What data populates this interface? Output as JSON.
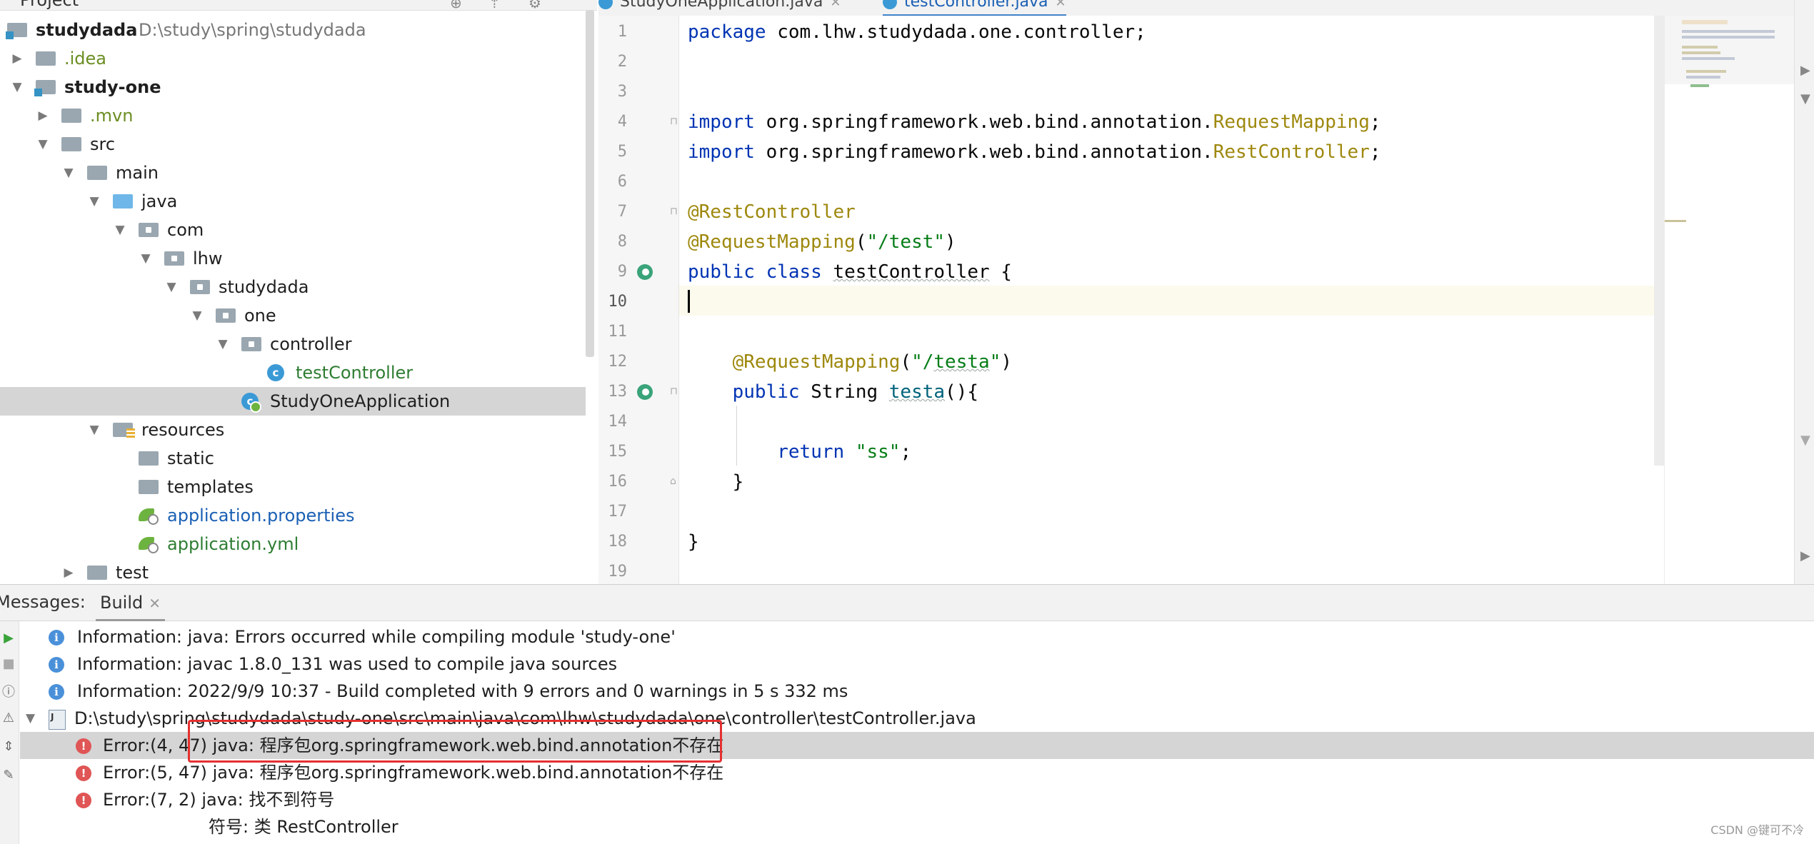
{
  "project": {
    "header": "Project",
    "tree": [
      {
        "label": "studydada",
        "path": "D:\\study\\spring\\studydada",
        "icon": "module",
        "depth": 0,
        "arrow": "none",
        "style": "bold"
      },
      {
        "label": ".idea",
        "icon": "folder",
        "depth": 0,
        "arrow": "right",
        "style": "olive"
      },
      {
        "label": "study-one",
        "icon": "module",
        "depth": 0,
        "arrow": "down",
        "style": "bold"
      },
      {
        "label": ".mvn",
        "icon": "folder",
        "depth": 1,
        "arrow": "right",
        "style": "olive"
      },
      {
        "label": "src",
        "icon": "folder",
        "depth": 1,
        "arrow": "down",
        "style": "normal"
      },
      {
        "label": "main",
        "icon": "folder",
        "depth": 2,
        "arrow": "down",
        "style": "normal"
      },
      {
        "label": "java",
        "icon": "folder-blue",
        "depth": 3,
        "arrow": "down",
        "style": "normal"
      },
      {
        "label": "com",
        "icon": "package",
        "depth": 4,
        "arrow": "down",
        "style": "normal"
      },
      {
        "label": "lhw",
        "icon": "package",
        "depth": 5,
        "arrow": "down",
        "style": "normal"
      },
      {
        "label": "studydada",
        "icon": "package",
        "depth": 6,
        "arrow": "down",
        "style": "normal"
      },
      {
        "label": "one",
        "icon": "package",
        "depth": 7,
        "arrow": "down",
        "style": "normal"
      },
      {
        "label": "controller",
        "icon": "package",
        "depth": 8,
        "arrow": "down",
        "style": "normal"
      },
      {
        "label": "testController",
        "icon": "class",
        "depth": 9,
        "arrow": "none",
        "style": "green"
      },
      {
        "label": "StudyOneApplication",
        "icon": "boot-class",
        "depth": 8,
        "arrow": "none",
        "style": "normal",
        "selected": true
      },
      {
        "label": "resources",
        "icon": "resources",
        "depth": 3,
        "arrow": "down",
        "style": "normal"
      },
      {
        "label": "static",
        "icon": "folder",
        "depth": 4,
        "arrow": "none",
        "style": "normal"
      },
      {
        "label": "templates",
        "icon": "folder",
        "depth": 4,
        "arrow": "none",
        "style": "normal"
      },
      {
        "label": "application.properties",
        "icon": "spring-leaf",
        "depth": 4,
        "arrow": "none",
        "style": "blue"
      },
      {
        "label": "application.yml",
        "icon": "spring-leaf",
        "depth": 4,
        "arrow": "none",
        "style": "green"
      },
      {
        "label": "test",
        "icon": "folder",
        "depth": 2,
        "arrow": "right",
        "style": "normal"
      }
    ]
  },
  "editor": {
    "tabs": [
      {
        "label": "StudyOneApplication.java",
        "active": false
      },
      {
        "label": "testController.java",
        "active": true
      }
    ],
    "current_line": 10,
    "lines": [
      {
        "n": "1",
        "html": "<span class=\"kw\">package</span> com.lhw.studydada.one.controller;"
      },
      {
        "n": "2",
        "html": ""
      },
      {
        "n": "3",
        "html": ""
      },
      {
        "n": "4",
        "html": "<span class=\"kw\">import</span> org.springframework.web.bind.annotation.<span class=\"cls\">RequestMapping</span>;"
      },
      {
        "n": "5",
        "html": "<span class=\"kw\">import</span> org.springframework.web.bind.annotation.<span class=\"cls\">RestController</span>;"
      },
      {
        "n": "6",
        "html": ""
      },
      {
        "n": "7",
        "html": "<span class=\"ann\">@RestController</span>"
      },
      {
        "n": "8",
        "html": "<span class=\"ann\">@RequestMapping</span>(<span class=\"str\">\"/test\"</span>)"
      },
      {
        "n": "9",
        "html": "<span class=\"kw\">public class</span> <span class=\"squig\">testController</span> {"
      },
      {
        "n": "10",
        "html": ""
      },
      {
        "n": "11",
        "html": ""
      },
      {
        "n": "12",
        "html": "    <span class=\"ann\">@RequestMapping</span>(<span class=\"str\">\"/<span class=\"squig\">testa</span>\"</span>)"
      },
      {
        "n": "13",
        "html": "    <span class=\"kw\">public</span> String <span class=\"fn squig\">testa</span>(){"
      },
      {
        "n": "14",
        "html": ""
      },
      {
        "n": "15",
        "html": "        <span class=\"kw\">return</span> <span class=\"str\">\"ss\"</span>;"
      },
      {
        "n": "16",
        "html": "    }"
      },
      {
        "n": "17",
        "html": ""
      },
      {
        "n": "18",
        "html": "}"
      },
      {
        "n": "19",
        "html": ""
      }
    ]
  },
  "messages": {
    "label": "Messages:",
    "tab": "Build",
    "rows": [
      {
        "type": "info",
        "text": "Information: java: Errors occurred while compiling module 'study-one'"
      },
      {
        "type": "info",
        "text": "Information: javac 1.8.0_131 was used to compile java sources"
      },
      {
        "type": "info",
        "text": "Information: 2022/9/9 10:37 - Build completed with 9 errors and 0 warnings in 5 s 332 ms"
      },
      {
        "type": "file",
        "text": "D:\\study\\spring\\studydada\\study-one\\src\\main\\java\\com\\lhw\\studydada\\one\\controller\\testController.java"
      },
      {
        "type": "error",
        "text": "Error:(4, 47)  java: 程序包org.springframework.web.bind.annotation不存在",
        "selected": true
      },
      {
        "type": "error",
        "text": "Error:(5, 47)  java: 程序包org.springframework.web.bind.annotation不存在"
      },
      {
        "type": "error",
        "text": "Error:(7, 2)  java: 找不到符号"
      },
      {
        "type": "detail",
        "text": "符号: 类 RestController"
      }
    ]
  },
  "watermark": "CSDN @键可不冷"
}
